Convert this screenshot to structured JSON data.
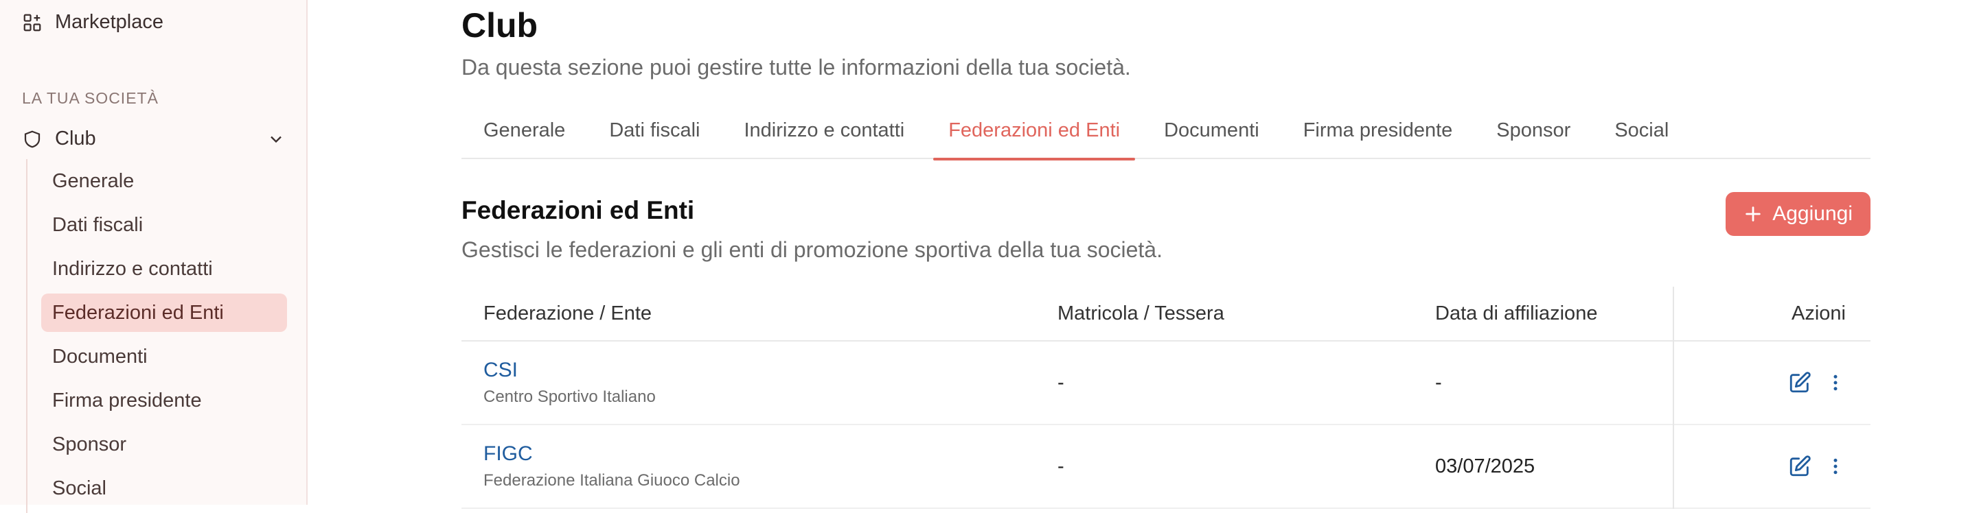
{
  "sidebar": {
    "marketplace": "Marketplace",
    "section_label": "LA TUA SOCIETÀ",
    "club_label": "Club",
    "sub_items": [
      {
        "label": "Generale"
      },
      {
        "label": "Dati fiscali"
      },
      {
        "label": "Indirizzo e contatti"
      },
      {
        "label": "Federazioni ed Enti"
      },
      {
        "label": "Documenti"
      },
      {
        "label": "Firma presidente"
      },
      {
        "label": "Sponsor"
      },
      {
        "label": "Social"
      }
    ],
    "active_index": 3
  },
  "header": {
    "title": "Club",
    "subtitle": "Da questa sezione puoi gestire tutte le informazioni della tua società."
  },
  "tabs": [
    {
      "label": "Generale"
    },
    {
      "label": "Dati fiscali"
    },
    {
      "label": "Indirizzo e contatti"
    },
    {
      "label": "Federazioni ed Enti"
    },
    {
      "label": "Documenti"
    },
    {
      "label": "Firma presidente"
    },
    {
      "label": "Sponsor"
    },
    {
      "label": "Social"
    }
  ],
  "active_tab": 3,
  "section": {
    "title": "Federazioni ed Enti",
    "subtitle": "Gestisci le federazioni e gli enti di promozione sportiva della tua società.",
    "add_button": "Aggiungi"
  },
  "table": {
    "headers": {
      "federation": "Federazione / Ente",
      "number": "Matricola / Tessera",
      "date": "Data di affiliazione",
      "actions": "Azioni"
    },
    "rows": [
      {
        "name": "CSI",
        "full_name": "Centro Sportivo Italiano",
        "number": "-",
        "date": "-"
      },
      {
        "name": "FIGC",
        "full_name": "Federazione Italiana Giuoco Calcio",
        "number": "-",
        "date": "03/07/2025"
      }
    ]
  },
  "colors": {
    "accent": "#e0655c",
    "button": "#e96b64",
    "link": "#1f5c9e",
    "sidebar_active": "#f9d8d5"
  },
  "icons": {
    "marketplace": "grid-plus-icon",
    "club": "shield-icon",
    "expand": "chevron-down-icon",
    "add": "plus-icon",
    "edit": "edit-icon",
    "more": "more-vertical-icon"
  }
}
